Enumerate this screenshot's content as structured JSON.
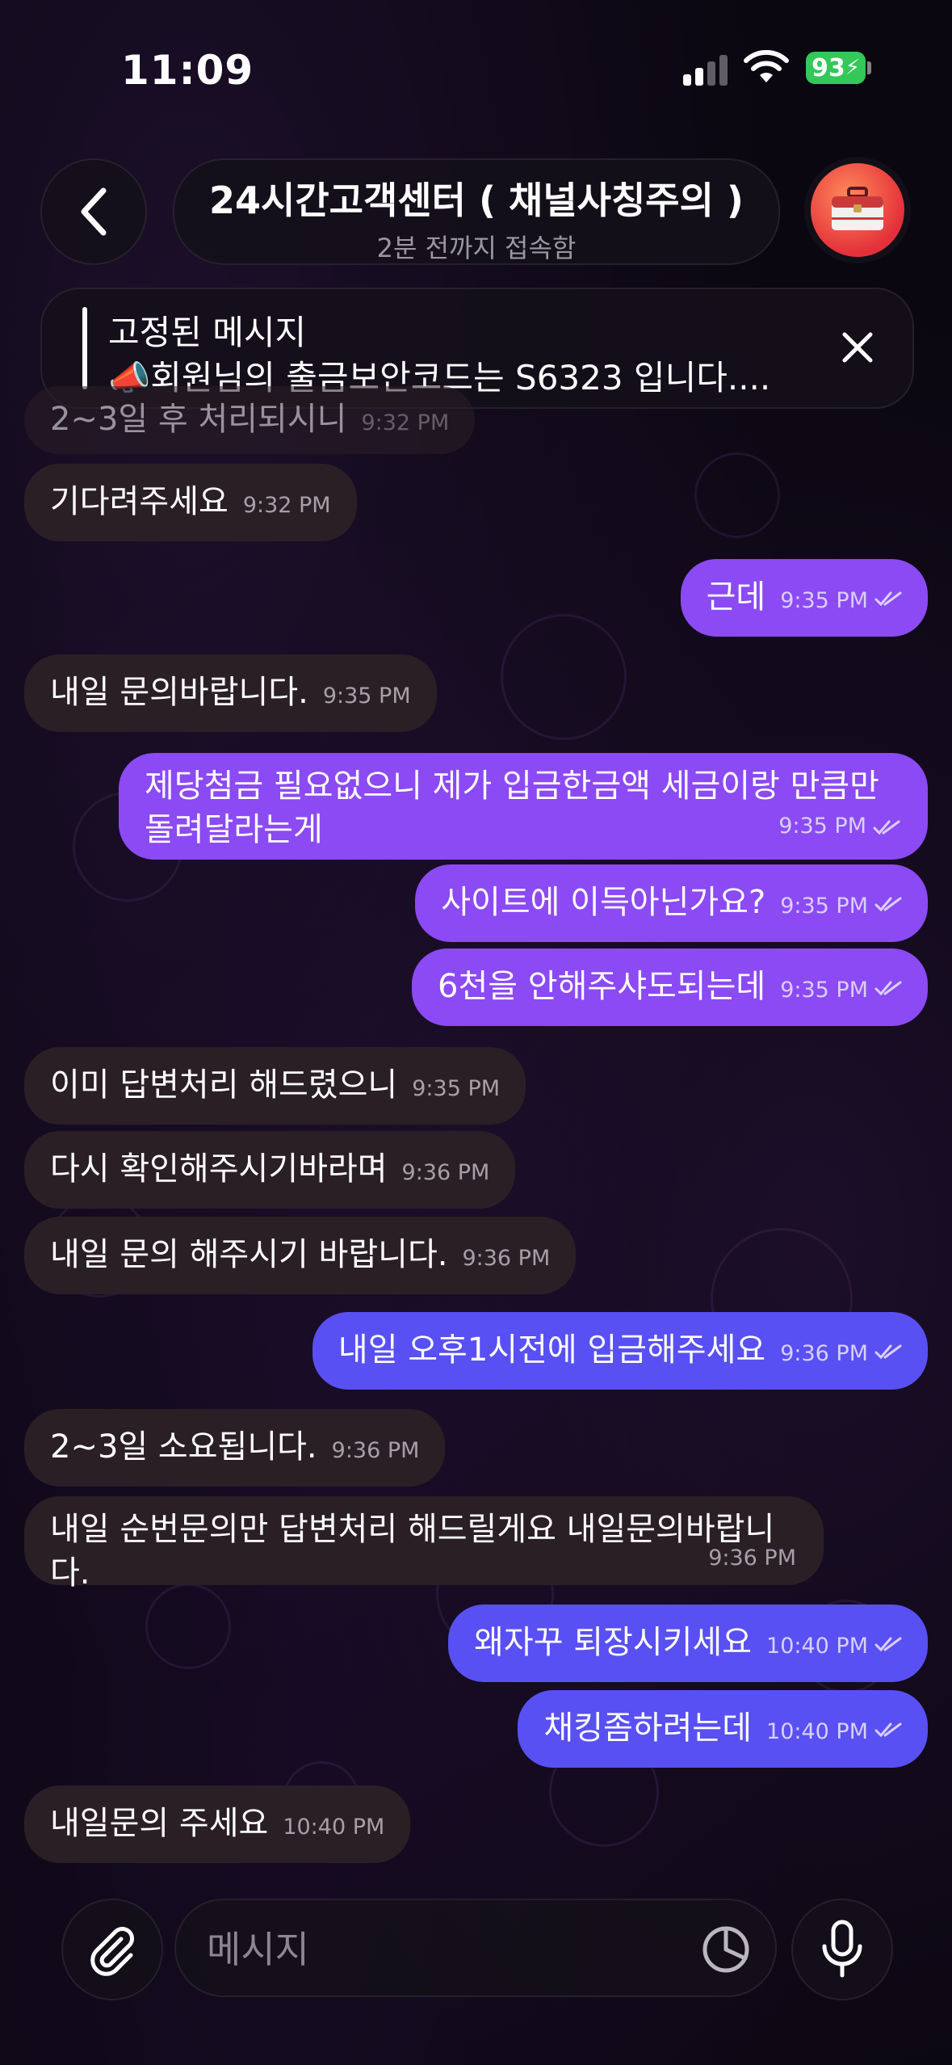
{
  "status_bar": {
    "time": "11:09",
    "battery": "93"
  },
  "header": {
    "title": "24시간고객센터 ( 채널사칭주의 )",
    "subtitle": "2분 전까지 접속함"
  },
  "pinned": {
    "title": "고정된 메시지",
    "text": "📣회원님의 출금보안코드는 S6323 입니다...."
  },
  "messages": [
    {
      "text": "2~3일 후 처리되시니",
      "time": "9:32 PM",
      "dir": "in"
    },
    {
      "text": "기다려주세요",
      "time": "9:32 PM",
      "dir": "in"
    },
    {
      "text": "근데",
      "time": "9:35 PM",
      "dir": "out"
    },
    {
      "text": "내일 문의바랍니다.",
      "time": "9:35 PM",
      "dir": "in"
    },
    {
      "text": "제당첨금 필요없으니 제가 입금한금액 세금이랑 만큼만 돌려달라는게",
      "time": "9:35 PM",
      "dir": "out"
    },
    {
      "text": "사이트에 이득아닌가요?",
      "time": "9:35 PM",
      "dir": "out"
    },
    {
      "text": "6천을 안해주샤도되는데",
      "time": "9:35 PM",
      "dir": "out"
    },
    {
      "text": "이미 답변처리 해드렸으니",
      "time": "9:35 PM",
      "dir": "in"
    },
    {
      "text": "다시 확인해주시기바라며",
      "time": "9:36 PM",
      "dir": "in"
    },
    {
      "text": "내일 문의 해주시기 바랍니다.",
      "time": "9:36 PM",
      "dir": "in"
    },
    {
      "text": "내일 오후1시전에 입금해주세요",
      "time": "9:36 PM",
      "dir": "out"
    },
    {
      "text": "2~3일 소요됩니다.",
      "time": "9:36 PM",
      "dir": "in"
    },
    {
      "text": "내일 순번문의만 답변처리 해드릴게요 내일문의바랍니다.",
      "time": "9:36 PM",
      "dir": "in"
    },
    {
      "text": "왜자꾸 퇴장시키세요",
      "time": "10:40 PM",
      "dir": "out"
    },
    {
      "text": "채킹좀하려는데",
      "time": "10:40 PM",
      "dir": "out"
    },
    {
      "text": "내일문의 주세요",
      "time": "10:40 PM",
      "dir": "in"
    }
  ],
  "composer": {
    "placeholder": "메시지"
  },
  "icons": {
    "back": "chevron-left-icon",
    "avatar": "toolbox-icon",
    "close": "close-icon",
    "attach": "paperclip-icon",
    "sticker": "sticker-icon",
    "mic": "microphone-icon"
  },
  "colors": {
    "incoming_bubble": "#2b1f26",
    "outgoing_bubble": "#8b4af3",
    "outgoing_bubble_alt": "#5850f2",
    "background": "#0b0710",
    "battery": "#34c759"
  }
}
